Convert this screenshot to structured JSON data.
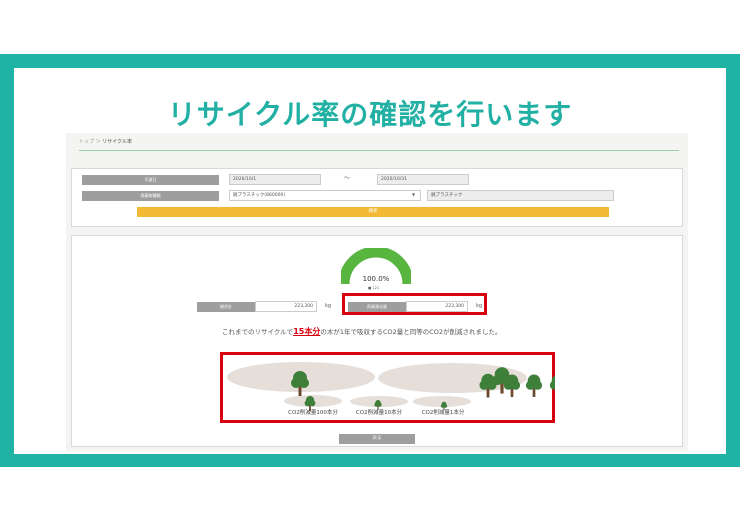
{
  "slide": {
    "headline": "リサイクル率の確認を行います"
  },
  "breadcrumb": {
    "home": "トップ",
    "separator": "＞",
    "current": "リサイクル率"
  },
  "filter": {
    "period_label": "引渡日",
    "date_from": "2020/10/1",
    "range_separator": "〜",
    "date_to": "2020/10/31",
    "material_label": "廃棄物種類",
    "material_value": "廃プラスチック(860000)",
    "material_name": "廃プラスチック",
    "search_label": "検索"
  },
  "result": {
    "gauge_percent": "100.0%",
    "gauge_value": 100.0,
    "gauge_legend": "■ 121",
    "total_label": "総合計",
    "total_value": "223,300",
    "total_unit": "kg",
    "recycled_label": "再資源化量",
    "recycled_value": "223,300",
    "recycled_unit": "kg",
    "message_before": "これまでのリサイクルで",
    "message_highlight": "15本分",
    "message_after": "の木が1年で吸収するCO2量と同等のCO2が削減されました。",
    "legend_100": "CO2削減量100本分",
    "legend_10": "CO2削減量10本分",
    "legend_1": "CO2削減量1本分",
    "back_label": "戻る"
  },
  "colors": {
    "teal": "#1fb3a6",
    "gauge_green": "#58b540",
    "highlight_red": "#d9000e",
    "search_yellow": "#f2b935",
    "tree_green": "#3e7f3a",
    "tree_trunk": "#6b4a2f"
  },
  "icons": [
    "tree-icon",
    "gauge-chart"
  ]
}
